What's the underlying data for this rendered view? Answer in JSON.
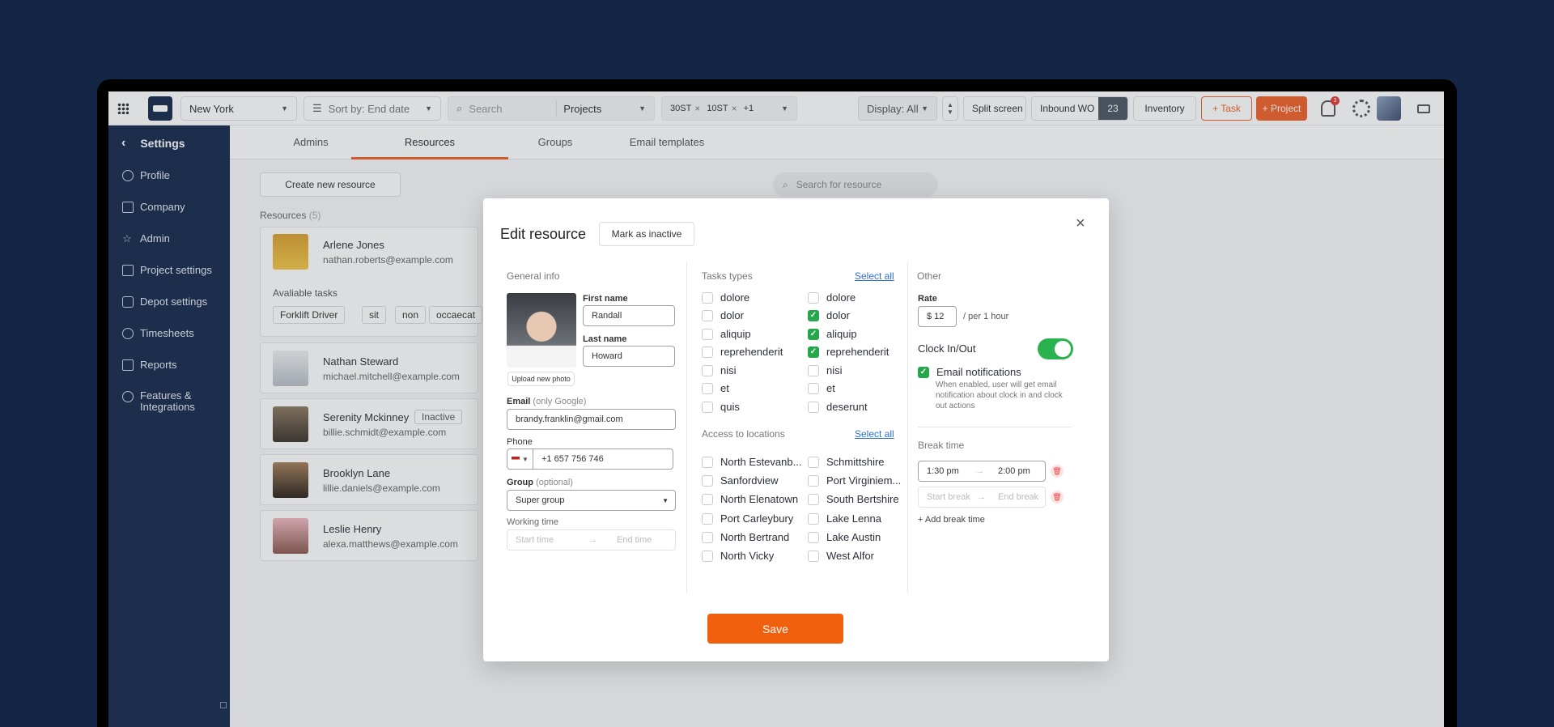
{
  "topbar": {
    "location": "New York",
    "sort": "Sort by: End date",
    "search_placeholder": "Search",
    "projects": "Projects",
    "chips": [
      "30ST",
      "10ST",
      "+1"
    ],
    "display": "Display: All",
    "split_screen": "Split screen",
    "inbound": "Inbound WO",
    "inbound_count": "23",
    "inventory": "Inventory",
    "add_task": "+ Task",
    "add_project": "+ Project",
    "notif_count": "3"
  },
  "sidebar": {
    "title": "Settings",
    "items": [
      "Profile",
      "Company",
      "Admin",
      "Project settings",
      "Depot settings",
      "Timesheets",
      "Reports",
      "Features & Integrations"
    ]
  },
  "tabs": [
    "Admins",
    "Resources",
    "Groups",
    "Email templates"
  ],
  "content": {
    "create_button": "Create new resource",
    "search_placeholder": "Search for resource",
    "resources_label": "Resources",
    "resources_count": "(5)",
    "available_tasks": "Avaliable tasks",
    "tasks": [
      "Forklift Driver",
      "sit",
      "non",
      "occaecat"
    ],
    "inactive_badge": "Inactive",
    "resources": [
      {
        "name": "Arlene Jones",
        "email": "nathan.roberts@example.com"
      },
      {
        "name": "Nathan Steward",
        "email": "michael.mitchell@example.com"
      },
      {
        "name": "Serenity Mckinney",
        "email": "billie.schmidt@example.com"
      },
      {
        "name": "Brooklyn Lane",
        "email": "lillie.daniels@example.com"
      },
      {
        "name": "Leslie Henry",
        "email": "alexa.matthews@example.com"
      }
    ]
  },
  "modal": {
    "title": "Edit resource",
    "mark_inactive": "Mark as inactive",
    "general_info": "General info",
    "first_name_label": "First name",
    "first_name": "Randall",
    "last_name_label": "Last name",
    "last_name": "Howard",
    "upload_photo": "Upload new photo",
    "email_label": "Email",
    "email_hint": "(only Google)",
    "email": "brandy.franklin@gmail.com",
    "phone_label": "Phone",
    "phone": "+1 657 756 746",
    "group_label": "Group",
    "group_hint": "(optional)",
    "group": "Super group",
    "working_time_label": "Working time",
    "start_time_ph": "Start time",
    "end_time_ph": "End time",
    "tasks_types": "Tasks types",
    "select_all": "Select all",
    "tasks_left": [
      "dolore",
      "dolor",
      "aliquip",
      "reprehenderit",
      "nisi",
      "et",
      "quis"
    ],
    "tasks_right": [
      "dolore",
      "dolor",
      "aliquip",
      "reprehenderit",
      "nisi",
      "et",
      "deserunt"
    ],
    "access_locations": "Access to locations",
    "locations_left": [
      "North Estevanb...",
      "Sanfordview",
      "North Elenatown",
      "Port Carleybury",
      "North Bertrand",
      "North Vicky"
    ],
    "locations_right": [
      "Schmittshire",
      "Port Virginiem...",
      "South Bertshire",
      "Lake Lenna",
      "Lake Austin",
      "West Alfor"
    ],
    "other": "Other",
    "rate_label": "Rate",
    "rate": "$ 12",
    "per_hour": "/ per 1 hour",
    "clock_in_out": "Clock In/Out",
    "email_notifications": "Email notifications",
    "email_notifications_desc": "When enabled, user will get email notification about clock in and clock out actions",
    "break_time": "Break time",
    "break_start": "1:30 pm",
    "break_end": "2:00 pm",
    "start_break_ph": "Start break",
    "end_break_ph": "End break",
    "add_break": "+ Add break time",
    "save": "Save"
  }
}
